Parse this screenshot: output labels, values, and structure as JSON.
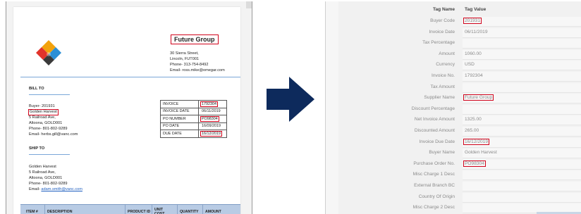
{
  "invoice_document": {
    "company": "Future Group",
    "company_address": [
      "30 Sierra Street,",
      "Lincoln, FUT001",
      "Phone- 313-754-8492",
      "Email- ross.mike@omegar.com"
    ],
    "bill_to_heading": "BILL TO",
    "bill_to_lines": [
      "Buyer- 201931",
      "Golden Harvest",
      "5 Railroad Ave,",
      "Altoona, GOLD001",
      "Phone- 801-802-9289",
      "Email- herbs.gill@vanc.com"
    ],
    "ship_to_heading": "SHIP TO",
    "ship_to_lines": [
      "Golden Harvest",
      "5 Railroad Ave,",
      "Altoona, GOLD001",
      "Phone- 801-802-9289"
    ],
    "ship_email_label": "Email-",
    "ship_email": "adam.smith@vanc.com",
    "invoice_table": [
      {
        "label": "INVOICE",
        "value": "1792304"
      },
      {
        "label": "INVOICE DATE",
        "value": "06/11/2019"
      },
      {
        "label": "PO NUMBER",
        "value": "PO98304"
      },
      {
        "label": "PO DATE",
        "value": "16/09/2019"
      },
      {
        "label": "DUE DATE",
        "value": "16/12/2019"
      }
    ],
    "items_columns": [
      "ITEM #",
      "DESCRIPTION",
      "PRODUCT ID",
      "UNIT COST",
      "QUANTITY",
      "AMOUNT"
    ]
  },
  "extraction_view": {
    "header": {
      "name": "Tag Name",
      "value": "Tag Value"
    },
    "rows": [
      {
        "name": "Buyer Code",
        "value": "201931"
      },
      {
        "name": "Invoice Date",
        "value": "06/11/2019"
      },
      {
        "name": "Tax Percentage",
        "value": ""
      },
      {
        "name": "Amount",
        "value": "1060.00"
      },
      {
        "name": "Currency",
        "value": "USD"
      },
      {
        "name": "Invoice No.",
        "value": "1792304"
      },
      {
        "name": "Tax Amount",
        "value": ""
      },
      {
        "name": "Supplier Name",
        "value": "Future Group"
      },
      {
        "name": "Discount Percentage",
        "value": ""
      },
      {
        "name": "Net Invoice Amount",
        "value": "1325.00"
      },
      {
        "name": "Discounted Amount",
        "value": "265.00"
      },
      {
        "name": "Invoice Due Date",
        "value": "16/12/2019"
      },
      {
        "name": "Buyer Name",
        "value": "Golden Harvest"
      },
      {
        "name": "Purchase Order No.",
        "value": "PO98304"
      },
      {
        "name": "Misc Charge 1 Desc",
        "value": ""
      },
      {
        "name": "External Branch BC",
        "value": ""
      },
      {
        "name": "Country Of Origin",
        "value": ""
      },
      {
        "name": "Misc Charge 2 Desc",
        "value": ""
      }
    ]
  },
  "colors": {
    "highlight": "#d0021b",
    "arrow": "#0d2a5c",
    "items_header": "#b8cbe4"
  }
}
